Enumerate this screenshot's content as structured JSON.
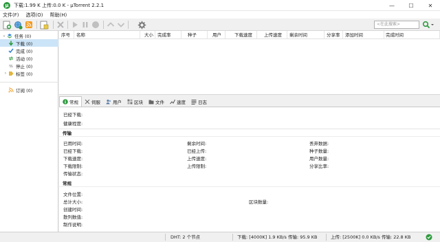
{
  "window": {
    "title": "下载:1.99 K 上传:0.0 K - µTorrent 2.2.1",
    "minimize": "—",
    "maximize": "☐",
    "close": "✕"
  },
  "menu": [
    "文件(F)",
    "选项(O)",
    "帮助(H)"
  ],
  "toolbar": {
    "icons": [
      "add-torrent-icon",
      "add-from-url-icon",
      "rss-icon",
      "create-torrent-icon",
      "remove-icon",
      "start-icon",
      "pause-icon",
      "stop-icon",
      "move-up-icon",
      "move-down-icon",
      "preferences-icon"
    ],
    "search_placeholder": "<在此搜索>",
    "search_icon": "search-icon"
  },
  "sidebar": {
    "categories": [
      {
        "label": "任务 (0)",
        "icon": "torrents-icon"
      },
      {
        "label": "下载 (0)",
        "icon": "download-arrow-icon"
      },
      {
        "label": "完成 (0)",
        "icon": "check-icon"
      },
      {
        "label": "活动 (0)",
        "icon": "activity-icon"
      },
      {
        "label": "停止 (0)",
        "icon": "stop-icon"
      },
      {
        "label": "标签 (0)",
        "icon": "label-icon"
      }
    ],
    "feeds": {
      "label": "订阅 (0)",
      "icon": "rss-feed-icon"
    }
  },
  "list": {
    "columns": [
      "序号",
      "名称",
      "大小",
      "完成率",
      "种子",
      "用户",
      "下载速度",
      "上传速度",
      "剩余时间",
      "分享率",
      "添加时间",
      "完成时间"
    ]
  },
  "tabs": [
    {
      "label": "常规",
      "icon": "info-icon"
    },
    {
      "label": "伺服",
      "icon": "trackers-icon"
    },
    {
      "label": "用户",
      "icon": "peers-icon"
    },
    {
      "label": "区块",
      "icon": "pieces-icon"
    },
    {
      "label": "文件",
      "icon": "folder-icon"
    },
    {
      "label": "速度",
      "icon": "speed-graph-icon"
    },
    {
      "label": "日志",
      "icon": "logger-icon"
    }
  ],
  "general": {
    "downloaded": "已经下载:",
    "availability": "健康程度:",
    "transfer": {
      "title": "传输",
      "col1": [
        "已用时间:",
        "已经下载:",
        "下载速度:",
        "下载限制:",
        "传输状态:"
      ],
      "col2": [
        "剩余时间:",
        "已经上传:",
        "上传速度:",
        "上传限制:"
      ],
      "col3": [
        "丢弃数据:",
        "种子数量:",
        "用户数量:",
        "分享比率:"
      ]
    },
    "general_section": {
      "title": "常规",
      "items": [
        "文件位置:",
        "总计大小:",
        "创建时间:",
        "散列数值:",
        "制作说明:"
      ],
      "pieces": "区块数量:"
    }
  },
  "status": {
    "dht": "DHT: 2 个节点",
    "download": "下载: [4000K] 1.9 KB/s 传输: 95.9 KB",
    "upload": "上传: [2500K] 0.0 KB/s 传输: 22.8 KB",
    "status_icon": "network-ok-icon"
  }
}
